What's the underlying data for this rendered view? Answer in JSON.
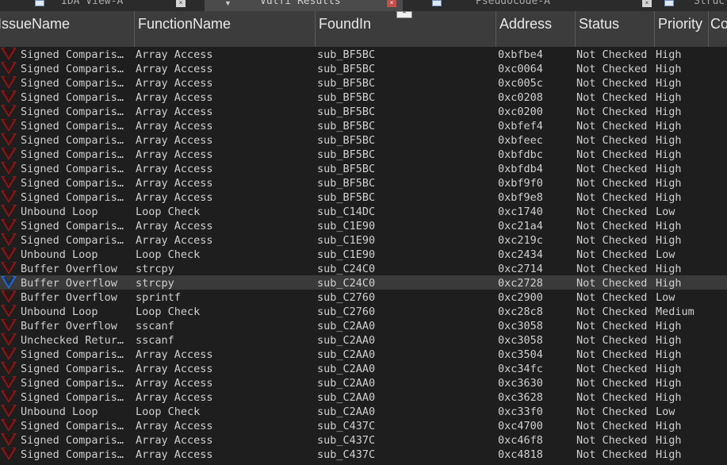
{
  "tabs": [
    {
      "label": "IDA View-A",
      "active": false
    },
    {
      "label": "Vulfi Results",
      "active": true
    },
    {
      "label": "Pseudocode-A",
      "active": false
    },
    {
      "label": "Struc",
      "active": false
    }
  ],
  "columns": [
    "IssueName",
    "FunctionName",
    "FoundIn",
    "Address",
    "Status",
    "Priority",
    "Co"
  ],
  "colors": {
    "background": "#1e1e1e",
    "header": "#3c3c3c",
    "row_selected": "#3a3a3a",
    "icon_red": "#8b1a1a",
    "icon_blue": "#2a6bd1"
  },
  "rows": [
    {
      "issue": "Signed Comparis…",
      "func": "Array Access",
      "found": "sub_BF5BC",
      "addr": "0xbfbe4",
      "status": "Not Checked",
      "prio": "High"
    },
    {
      "issue": "Signed Comparis…",
      "func": "Array Access",
      "found": "sub_BF5BC",
      "addr": "0xc0064",
      "status": "Not Checked",
      "prio": "High"
    },
    {
      "issue": "Signed Comparis…",
      "func": "Array Access",
      "found": "sub_BF5BC",
      "addr": "0xc005c",
      "status": "Not Checked",
      "prio": "High"
    },
    {
      "issue": "Signed Comparis…",
      "func": "Array Access",
      "found": "sub_BF5BC",
      "addr": "0xc0208",
      "status": "Not Checked",
      "prio": "High"
    },
    {
      "issue": "Signed Comparis…",
      "func": "Array Access",
      "found": "sub_BF5BC",
      "addr": "0xc0200",
      "status": "Not Checked",
      "prio": "High"
    },
    {
      "issue": "Signed Comparis…",
      "func": "Array Access",
      "found": "sub_BF5BC",
      "addr": "0xbfef4",
      "status": "Not Checked",
      "prio": "High"
    },
    {
      "issue": "Signed Comparis…",
      "func": "Array Access",
      "found": "sub_BF5BC",
      "addr": "0xbfeec",
      "status": "Not Checked",
      "prio": "High"
    },
    {
      "issue": "Signed Comparis…",
      "func": "Array Access",
      "found": "sub_BF5BC",
      "addr": "0xbfdbc",
      "status": "Not Checked",
      "prio": "High"
    },
    {
      "issue": "Signed Comparis…",
      "func": "Array Access",
      "found": "sub_BF5BC",
      "addr": "0xbfdb4",
      "status": "Not Checked",
      "prio": "High"
    },
    {
      "issue": "Signed Comparis…",
      "func": "Array Access",
      "found": "sub_BF5BC",
      "addr": "0xbf9f0",
      "status": "Not Checked",
      "prio": "High"
    },
    {
      "issue": "Signed Comparis…",
      "func": "Array Access",
      "found": "sub_BF5BC",
      "addr": "0xbf9e8",
      "status": "Not Checked",
      "prio": "High"
    },
    {
      "issue": "Unbound Loop",
      "func": "Loop Check",
      "found": "sub_C14DC",
      "addr": "0xc1740",
      "status": "Not Checked",
      "prio": "Low"
    },
    {
      "issue": "Signed Comparis…",
      "func": "Array Access",
      "found": "sub_C1E90",
      "addr": "0xc21a4",
      "status": "Not Checked",
      "prio": "High"
    },
    {
      "issue": "Signed Comparis…",
      "func": "Array Access",
      "found": "sub_C1E90",
      "addr": "0xc219c",
      "status": "Not Checked",
      "prio": "High"
    },
    {
      "issue": "Unbound Loop",
      "func": "Loop Check",
      "found": "sub_C1E90",
      "addr": "0xc2434",
      "status": "Not Checked",
      "prio": "Low"
    },
    {
      "issue": "Buffer Overflow",
      "func": "strcpy",
      "found": "sub_C24C0",
      "addr": "0xc2714",
      "status": "Not Checked",
      "prio": "High"
    },
    {
      "issue": "Buffer Overflow",
      "func": "strcpy",
      "found": "sub_C24C0",
      "addr": "0xc2728",
      "status": "Not Checked",
      "prio": "High",
      "selected": true
    },
    {
      "issue": "Buffer Overflow",
      "func": "sprintf",
      "found": "sub_C2760",
      "addr": "0xc2900",
      "status": "Not Checked",
      "prio": "Low"
    },
    {
      "issue": "Unbound Loop",
      "func": "Loop Check",
      "found": "sub_C2760",
      "addr": "0xc28c8",
      "status": "Not Checked",
      "prio": "Medium"
    },
    {
      "issue": "Buffer Overflow",
      "func": "sscanf",
      "found": "sub_C2AA0",
      "addr": "0xc3058",
      "status": "Not Checked",
      "prio": "High"
    },
    {
      "issue": "Unchecked Retur…",
      "func": "sscanf",
      "found": "sub_C2AA0",
      "addr": "0xc3058",
      "status": "Not Checked",
      "prio": "High"
    },
    {
      "issue": "Signed Comparis…",
      "func": "Array Access",
      "found": "sub_C2AA0",
      "addr": "0xc3504",
      "status": "Not Checked",
      "prio": "High"
    },
    {
      "issue": "Signed Comparis…",
      "func": "Array Access",
      "found": "sub_C2AA0",
      "addr": "0xc34fc",
      "status": "Not Checked",
      "prio": "High"
    },
    {
      "issue": "Signed Comparis…",
      "func": "Array Access",
      "found": "sub_C2AA0",
      "addr": "0xc3630",
      "status": "Not Checked",
      "prio": "High"
    },
    {
      "issue": "Signed Comparis…",
      "func": "Array Access",
      "found": "sub_C2AA0",
      "addr": "0xc3628",
      "status": "Not Checked",
      "prio": "High"
    },
    {
      "issue": "Unbound Loop",
      "func": "Loop Check",
      "found": "sub_C2AA0",
      "addr": "0xc33f0",
      "status": "Not Checked",
      "prio": "Low"
    },
    {
      "issue": "Signed Comparis…",
      "func": "Array Access",
      "found": "sub_C437C",
      "addr": "0xc4700",
      "status": "Not Checked",
      "prio": "High"
    },
    {
      "issue": "Signed Comparis…",
      "func": "Array Access",
      "found": "sub_C437C",
      "addr": "0xc46f8",
      "status": "Not Checked",
      "prio": "High"
    },
    {
      "issue": "Signed Comparis…",
      "func": "Array Access",
      "found": "sub_C437C",
      "addr": "0xc4818",
      "status": "Not Checked",
      "prio": "High"
    }
  ]
}
